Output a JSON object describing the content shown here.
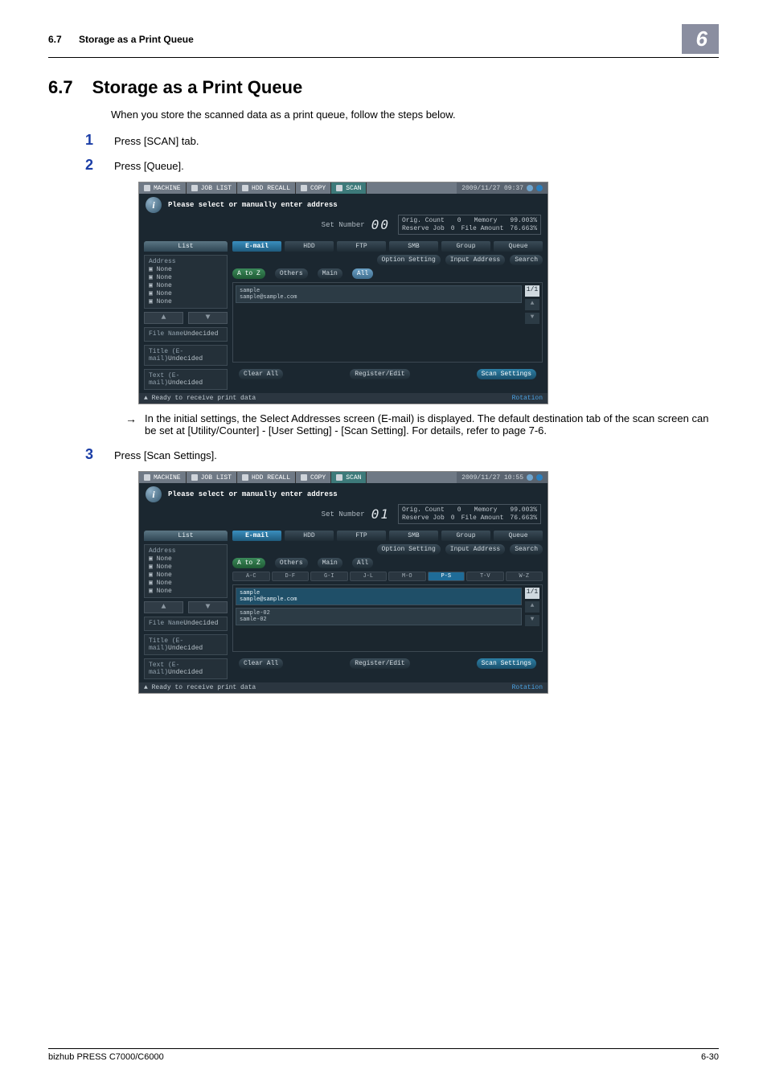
{
  "running_head": {
    "number": "6.7",
    "title": "Storage as a Print Queue",
    "chapter_badge": "6"
  },
  "section": {
    "number": "6.7",
    "title": "Storage as a Print Queue"
  },
  "intro": "When you store the scanned data as a print queue, follow the steps below.",
  "steps": {
    "s1": {
      "num": "1",
      "text": "Press [SCAN] tab."
    },
    "s2": {
      "num": "2",
      "text": "Press [Queue]."
    },
    "s3": {
      "num": "3",
      "text": "Press [Scan Settings]."
    }
  },
  "note": {
    "arrow": "→",
    "text": "In the initial settings, the Select Addresses screen (E-mail) is displayed.  The default destination tab of the scan screen can be set at [Utility/Counter] - [User Setting] - [Scan Setting]. For details, refer to page 7-6."
  },
  "screenA": {
    "tabs": {
      "machine": "MACHINE",
      "joblist": "JOB LIST",
      "hdd": "HDD RECALL",
      "copy": "COPY",
      "scan": "SCAN"
    },
    "datetime": "2009/11/27 09:37",
    "info_icon": "i",
    "msg": "Please select or manually enter address",
    "set_number_label": "Set Number",
    "set_number_value": "00",
    "orig": {
      "count_lbl": "Orig. Count",
      "count_val": "0",
      "mem_lbl": "Memory",
      "mem_val": "99.003%",
      "rsv_lbl": "Reserve Job",
      "rsv_val": "0",
      "file_lbl": "File Amount",
      "file_val": "76.663%"
    },
    "left_tabs": {
      "list": "List"
    },
    "address_hdr": "Address",
    "none": "None",
    "file_name_lbl": "File Name",
    "undecided": "Undecided",
    "title_lbl": "Title (E-mail)",
    "text_lbl": "Text (E-mail)",
    "mode_tabs": {
      "email": "E-mail",
      "hdd": "HDD",
      "ftp": "FTP",
      "smb": "SMB",
      "group": "Group",
      "queue": "Queue"
    },
    "line_btns": {
      "opt": "Option Setting",
      "inp": "Input Address",
      "sea": "Search"
    },
    "row2": {
      "atoz": "A to Z",
      "others": "Others",
      "main": "Main",
      "all": "All"
    },
    "entry1_name": "sample",
    "entry1_addr": "sample@sample.com",
    "scroll": {
      "frac": "1/1",
      "up": "▲",
      "down": "▼"
    },
    "footer_btns": {
      "clear": "Clear All",
      "reg": "Register/Edit",
      "scan": "Scan Settings"
    },
    "status": "Ready to receive print data",
    "rotation": "Rotation"
  },
  "screenB": {
    "datetime": "2009/11/27 10:55",
    "set_number_value": "01",
    "alpha": {
      "ac": "A-C",
      "df": "D-F",
      "gi": "G-I",
      "jl": "J-L",
      "mo": "M-O",
      "ps": "P-S",
      "tv": "T-V",
      "wz": "W-Z"
    },
    "entry2_name": "sample-02",
    "entry2_addr": "samle-02"
  },
  "footer": {
    "left": "bizhub PRESS C7000/C6000",
    "right": "6-30"
  }
}
